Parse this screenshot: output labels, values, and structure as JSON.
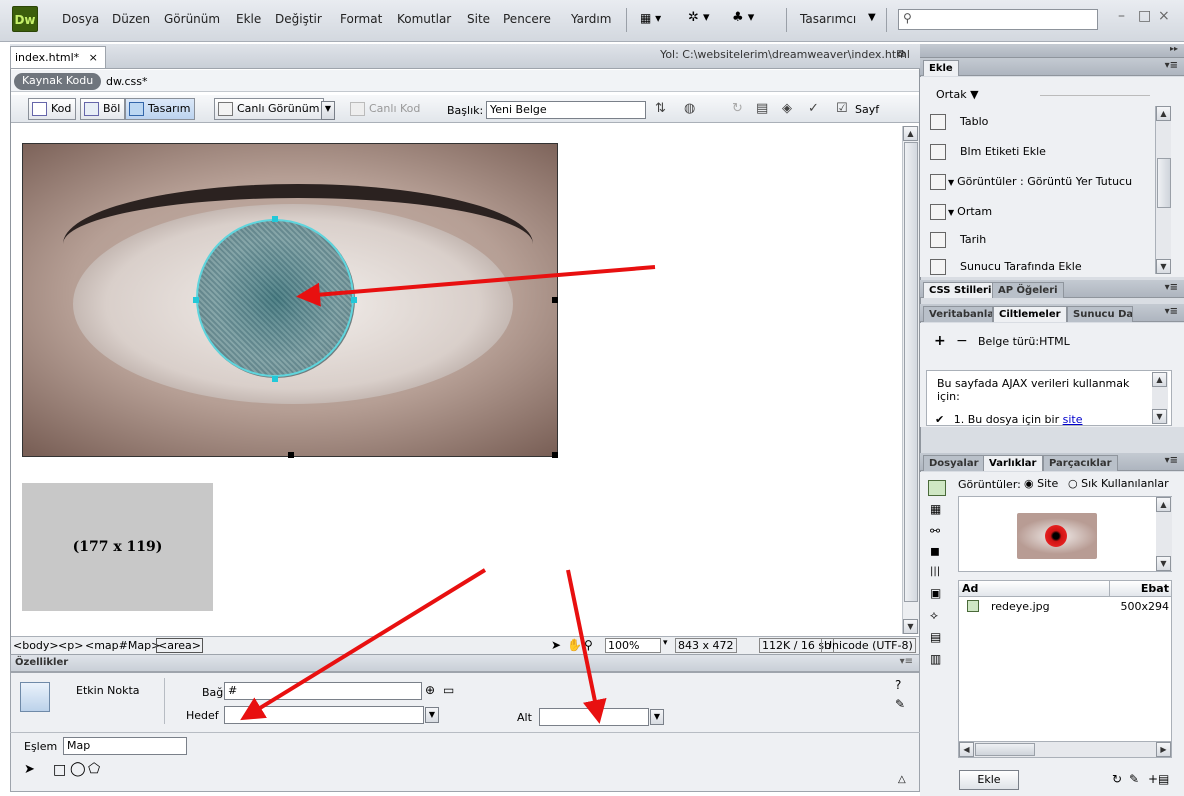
{
  "app": {
    "logo": "Dw"
  },
  "menu": [
    "Dosya",
    "Düzen",
    "Görünüm",
    "Ekle",
    "Değiştir",
    "Format",
    "Komutlar",
    "Site",
    "Pencere",
    "Yardım"
  ],
  "workspace": {
    "label": "Tasarımcı"
  },
  "window_controls": {
    "minimize": "–",
    "restore": "□",
    "close": "×"
  },
  "document": {
    "tab_label": "index.html*",
    "tab_close": "×",
    "path": "Yol: C:\\websitelerim\\dreamweaver\\index.html",
    "source_pill": "Kaynak Kodu",
    "related_file": "dw.css*"
  },
  "toolbar": {
    "code": "Kod",
    "split": "Böl",
    "design": "Tasarım",
    "live_view": "Canlı Görünüm",
    "live_code": "Canlı Kod",
    "title_label": "Başlık:",
    "title_value": "Yeni Belge",
    "page_trunc": "Sayf"
  },
  "canvas": {
    "placeholder_label": "(177 x 119)"
  },
  "statusbar": {
    "tag_body": "<body>",
    "tag_p": "<p>",
    "tag_map": "<map#Map>",
    "tag_area": "<area>",
    "zoom": "100%",
    "window_size": "843 x 472",
    "download": "112K / 16 sn",
    "encoding": "Unicode (UTF-8)"
  },
  "properties": {
    "title": "Özellikler",
    "element": "Etkin Nokta",
    "link_label": "Bağ",
    "link_value": "#",
    "target_label": "Hedef",
    "target_value": "",
    "alt_label": "Alt",
    "alt_value": "",
    "map_label": "Eşlem",
    "map_value": "Map"
  },
  "insert_panel": {
    "title": "Ekle",
    "category": "Ortak",
    "items": [
      "Tablo",
      "Blm Etiketi Ekle",
      "Görüntüler : Görüntü Yer Tutucu",
      "Ortam",
      "Tarih",
      "Sunucu Tarafında Ekle"
    ]
  },
  "css_panel": {
    "tabs": [
      "CSS Stilleri",
      "AP Öğeleri"
    ]
  },
  "bindings_panel": {
    "tabs": [
      "Veritabanla",
      "Ciltlemeler",
      "Sunucu Dav"
    ],
    "plus": "+",
    "minus": "−",
    "doc_type": "Belge türü:HTML",
    "message": "Bu sayfada AJAX verileri kullanmak için:",
    "step_prefix": "1.  Bu dosya için bir",
    "step_link": "site"
  },
  "files_panel": {
    "tabs": [
      "Dosyalar",
      "Varlıklar",
      "Parçacıklar"
    ],
    "images_label": "Görüntüler:",
    "opt_site": "Site",
    "opt_fav": "Sık Kullanılanlar",
    "col_name": "Ad",
    "col_size": "Ebat",
    "file_name": "redeye.jpg",
    "file_size": "500x294",
    "insert_button": "Ekle"
  },
  "colors": {
    "annotation_arrow": "#e81010",
    "hotspot_outline": "#5fd5dd",
    "placeholder_bg": "#c8c8c8"
  }
}
